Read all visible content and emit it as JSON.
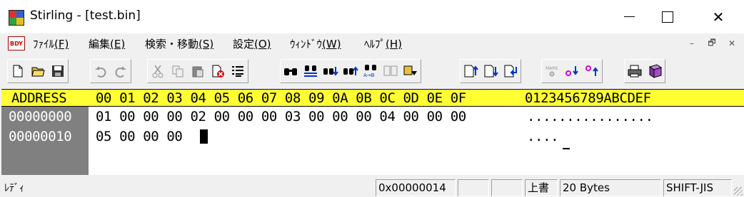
{
  "window": {
    "title": "Stirling - [test.bin]",
    "close_glyph": "✕"
  },
  "menu": {
    "doc_icon_text": "BDY",
    "items": [
      {
        "text": "ﾌｧｲﾙ",
        "key": "(F)"
      },
      {
        "text": "編集",
        "key": "(E)"
      },
      {
        "text": "検索・移動",
        "key": "(S)"
      },
      {
        "text": "設定",
        "key": "(O)"
      },
      {
        "text": "ｳｨﾝﾄﾞｳ",
        "key": "(W)"
      },
      {
        "text": "ﾍﾙﾌﾟ",
        "key": "(H)"
      }
    ],
    "mdi_min": "–",
    "mdi_restore": "🗗",
    "mdi_close": "✕"
  },
  "toolbar": {
    "groups": [
      [
        "new-file-icon",
        "open-folder-icon",
        "save-disk-icon"
      ],
      [
        "undo-icon",
        "redo-icon"
      ],
      [
        "cut-icon",
        "copy-icon",
        "paste-icon",
        "delete-icon",
        "list-icon"
      ],
      [
        "find-icon",
        "find-replace-icon",
        "find-next-down-icon",
        "find-next-up-icon",
        "replace-icon",
        "compare-icon",
        "jump-icon"
      ],
      [
        "page-up-icon",
        "page-down-icon",
        "insert-icon"
      ],
      [
        "mark-icon",
        "mark-next-icon",
        "mark-prev-icon"
      ],
      [
        "print-icon",
        "help-book-icon"
      ]
    ]
  },
  "hexview": {
    "header": {
      "address_label": "ADDRESS",
      "columns": "00 01 02 03 04 05 06 07 08 09 0A 0B 0C 0D 0E 0F",
      "ascii_label": "0123456789ABCDEF"
    },
    "rows": [
      {
        "address": "00000000",
        "hex": "01 00 00 00 02 00 00 00 03 00 00 00 04 00 00 00",
        "ascii": "................"
      },
      {
        "address": "00000010",
        "hex": "05 00 00 00",
        "ascii": "...."
      }
    ],
    "colors": {
      "header_bg": "#ffff33",
      "address_bg": "#808080"
    }
  },
  "statusbar": {
    "status_text": "ﾚﾃﾞｨ",
    "offset": "0x00000014",
    "mode": "上書",
    "size": "20 Bytes",
    "encoding": "SHIFT-JIS"
  }
}
